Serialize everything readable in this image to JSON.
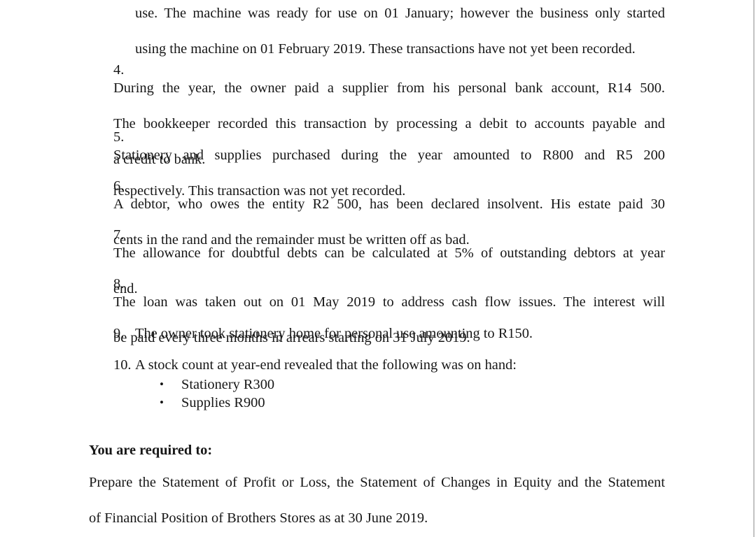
{
  "document": {
    "continuation_paragraph": {
      "line1": "use. The machine was ready for use on 01 January; however the business only started",
      "line2": "using the machine on 01 February 2019. These transactions have not yet been recorded."
    },
    "numbered_items": [
      {
        "number": "4.",
        "text": "During the year, the owner paid a supplier from his personal bank account, R14 500. The bookkeeper recorded this transaction by processing a debit to accounts payable and a credit to bank.",
        "line1": "During the year, the owner paid a supplier from his personal bank account, R14 500.",
        "line2": "The bookkeeper recorded this transaction by processing a debit to accounts payable and",
        "line3": "a credit to bank."
      },
      {
        "number": "5.",
        "text": "Stationery and supplies purchased during the year amounted to R800 and R5 200 respectively. This transaction was not yet recorded.",
        "line1": "Stationery and supplies purchased during the year amounted to R800 and R5 200",
        "line2": "respectively. This transaction was not yet recorded.",
        "line3": ""
      },
      {
        "number": "6.",
        "text": "A debtor, who owes the entity R2 500, has been declared insolvent. His estate paid 30 cents in the rand and the remainder must be written off as bad.",
        "line1": "A debtor, who owes the entity R2 500, has been declared insolvent. His estate paid 30",
        "line2": "cents in the rand and the remainder must be written off as bad.",
        "line3": ""
      },
      {
        "number": "7.",
        "text": "The allowance for doubtful debts can be calculated at 5% of outstanding debtors at year end.",
        "line1": "The allowance for doubtful debts can be calculated at 5% of outstanding debtors at year",
        "line2": "end.",
        "line3": ""
      },
      {
        "number": "8.",
        "text": "The loan was taken out on 01 May 2019 to address cash flow issues. The interest will be paid every three months in arrears starting on 31 July 2019.",
        "line1": "The loan was taken out on 01 May 2019 to address cash flow issues. The interest will",
        "line2": "be paid every three months in arrears starting on 31 July 2019.",
        "line3": ""
      },
      {
        "number": "9.",
        "text": "The owner took stationery home for personal use amounting to R150.",
        "line1": "The owner took stationery home for personal use amounting to R150.",
        "line2": "",
        "line3": ""
      },
      {
        "number": "10.",
        "text": "A stock count at year-end revealed that the following was on hand:",
        "line1": "A stock count at year-end revealed that the following was on hand:",
        "line2": "",
        "line3": ""
      }
    ],
    "stock_count_bullets": [
      {
        "marker": "•",
        "label": "Stationery R300"
      },
      {
        "marker": "•",
        "label": "Supplies R900"
      }
    ],
    "required_heading": "You are required to:",
    "closing_paragraph": {
      "line1": "Prepare the Statement of Profit or Loss, the Statement of Changes in Equity and the Statement",
      "line2": "of Financial Position of Brothers Stores as at 30 June 2019."
    }
  },
  "colors": {
    "page_background": "#ffffff",
    "body_text": "#171717",
    "edge_rule": "#c3c3c3"
  }
}
